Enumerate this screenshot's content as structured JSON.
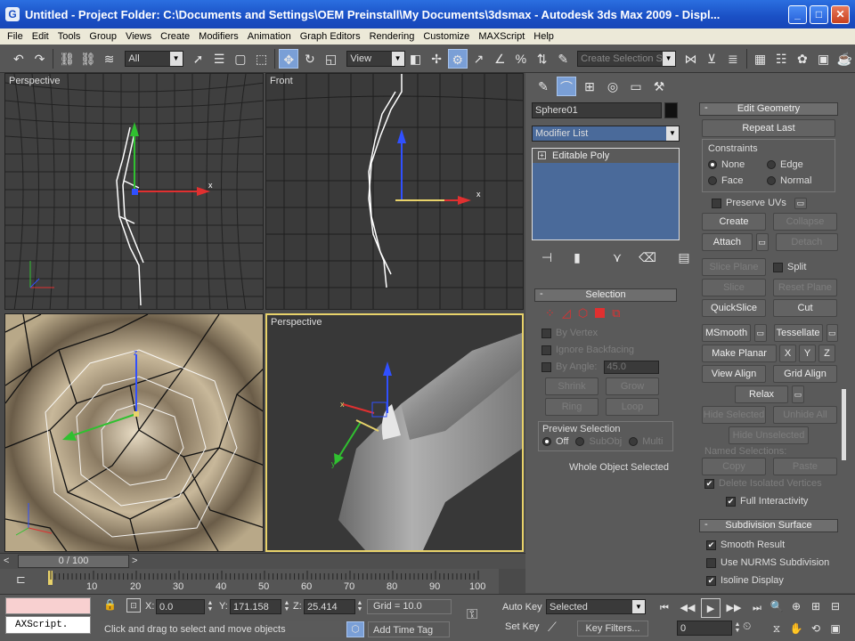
{
  "window": {
    "title": "Untitled    - Project Folder: C:\\Documents and Settings\\OEM Preinstall\\My Documents\\3dsmax    - Autodesk 3ds Max  2009    - Displ...",
    "app_icon_letter": "G",
    "minimize": "_",
    "maximize": "□",
    "close": "✕"
  },
  "menu": [
    "File",
    "Edit",
    "Tools",
    "Group",
    "Views",
    "Create",
    "Modifiers",
    "Animation",
    "Graph Editors",
    "Rendering",
    "Customize",
    "MAXScript",
    "Help"
  ],
  "toolbar": {
    "selection_filter": "All",
    "reference_coord": "View",
    "named_selection_placeholder": "Create Selection Se"
  },
  "viewports": {
    "top_left": "Perspective",
    "top_right": "Front",
    "bottom_right": "Perspective",
    "axis_x": "x",
    "axis_y": "y",
    "axis_z": "z"
  },
  "command_panel": {
    "object_name": "Sphere01",
    "modifier_list": "Modifier List",
    "stack_item": "Editable Poly",
    "selection": {
      "title": "Selection",
      "by_vertex": "By Vertex",
      "ignore_backfacing": "Ignore Backfacing",
      "by_angle": "By Angle:",
      "angle_value": "45.0",
      "shrink": "Shrink",
      "grow": "Grow",
      "ring": "Ring",
      "loop": "Loop",
      "preview_title": "Preview Selection",
      "preview_off": "Off",
      "preview_subobj": "SubObj",
      "preview_multi": "Multi",
      "status": "Whole Object Selected"
    }
  },
  "edit_geometry": {
    "title": "Edit Geometry",
    "repeat_last": "Repeat Last",
    "constraints": "Constraints",
    "none": "None",
    "edge": "Edge",
    "face": "Face",
    "normal": "Normal",
    "preserve_uvs": "Preserve UVs",
    "create": "Create",
    "collapse": "Collapse",
    "attach": "Attach",
    "detach": "Detach",
    "slice_plane": "Slice Plane",
    "split": "Split",
    "slice": "Slice",
    "reset_plane": "Reset Plane",
    "quickslice": "QuickSlice",
    "cut": "Cut",
    "msmooth": "MSmooth",
    "tessellate": "Tessellate",
    "make_planar": "Make Planar",
    "x": "X",
    "y": "Y",
    "z": "Z",
    "view_align": "View Align",
    "grid_align": "Grid Align",
    "relax": "Relax",
    "hide_selected": "Hide Selected",
    "unhide_all": "Unhide All",
    "hide_unselected": "Hide Unselected",
    "named_selections": "Named Selections:",
    "copy": "Copy",
    "paste": "Paste",
    "delete_isolated": "Delete Isolated Vertices",
    "full_interactivity": "Full Interactivity"
  },
  "subdivision_surface": {
    "title": "Subdivision Surface",
    "smooth_result": "Smooth Result",
    "use_nurms": "Use NURMS Subdivision",
    "isoline_display": "Isoline Display"
  },
  "timeline": {
    "frame": "0 / 100",
    "ticks": [
      "0",
      "10",
      "20",
      "30",
      "40",
      "50",
      "60",
      "70",
      "80",
      "90",
      "100"
    ]
  },
  "status": {
    "maxscript": "AXScript.",
    "x_label": "X:",
    "x_value": "0.0",
    "y_label": "Y:",
    "y_value": "171.158",
    "z_label": "Z:",
    "z_value": "25.414",
    "grid": "Grid = 10.0",
    "prompt": "Click and drag to select and move objects",
    "add_time_tag": "Add Time Tag",
    "auto_key": "Auto Key",
    "selected": "Selected",
    "set_key": "Set Key",
    "key_filters": "Key Filters...",
    "frame_value": "0"
  },
  "colors": {
    "titlebar": "#1a4fc4",
    "active_viewport": "#e8d26a",
    "axis_x": "#e03030",
    "axis_y": "#30c030",
    "axis_z": "#3050ff",
    "selected_wire": "#ffffff"
  }
}
